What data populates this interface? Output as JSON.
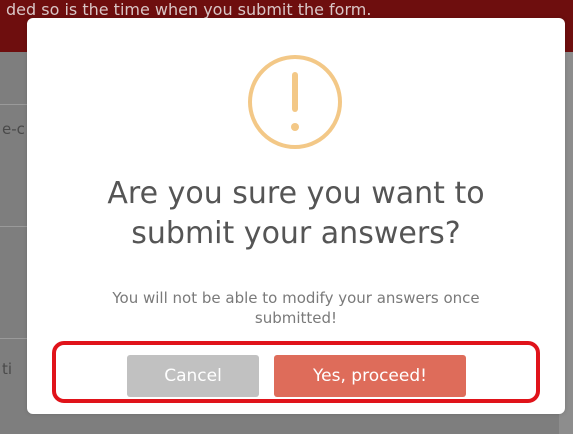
{
  "background": {
    "banner_text": "ded so is the time when you submit the form.",
    "fragment_1": "e-c",
    "fragment_2": "ti"
  },
  "dialog": {
    "icon": "exclamation-circle-icon",
    "title_line1": "Are you sure you want to",
    "title_line2": "submit your answers?",
    "message_line1": "You will not be able to modify your answers once",
    "message_line2": "submitted!",
    "cancel_label": "Cancel",
    "confirm_label": "Yes, proceed!"
  },
  "colors": {
    "banner": "#6e0e0e",
    "icon_ring": "#f3c887",
    "confirm_button": "#de6c5a",
    "cancel_button": "#c1c1c1",
    "highlight": "#e0131a"
  }
}
